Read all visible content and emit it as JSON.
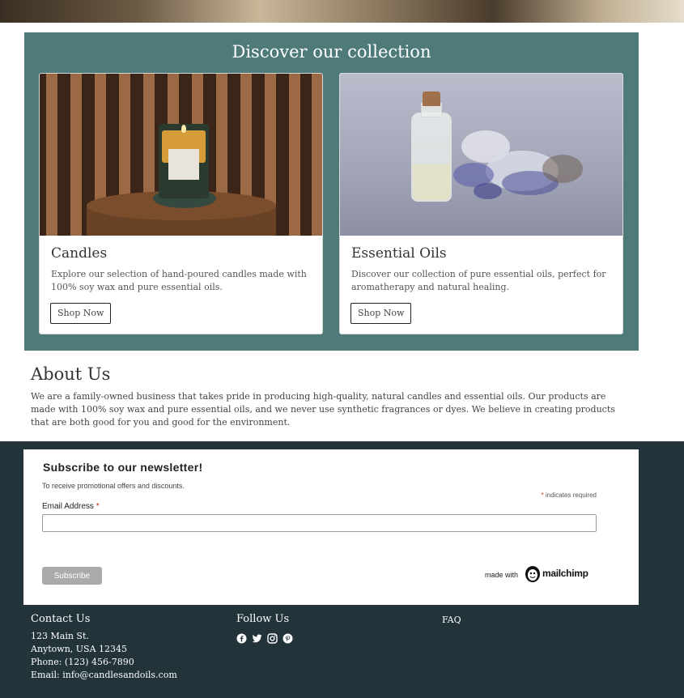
{
  "collection": {
    "title": "Discover our collection",
    "cards": [
      {
        "title": "Candles",
        "description": "Explore our selection of hand-poured candles made with 100% soy wax and pure essential oils.",
        "button": "Shop Now"
      },
      {
        "title": "Essential Oils",
        "description": "Discover our collection of pure essential oils, perfect for aromatherapy and natural healing.",
        "button": "Shop Now"
      }
    ]
  },
  "about": {
    "title": "About Us",
    "text": "We are a family-owned business that takes pride in producing high-quality, natural candles and essential oils. Our products are made with 100% soy wax and pure essential oils, and we never use synthetic fragrances or dyes. We believe in creating products that are both good for you and good for the environment."
  },
  "newsletter": {
    "title": "Subscribe to our newsletter!",
    "promo": "To receive promotional offers and discounts.",
    "required_star": "*",
    "required_note": "indicates required",
    "email_label": "Email Address",
    "email_value": "",
    "subscribe_label": "Subscribe",
    "made_with": "made with",
    "brand": "mailchimp"
  },
  "footer": {
    "contact_title": "Contact Us",
    "contact_lines": [
      "123 Main St.",
      "Anytown, USA 12345",
      "Phone: (123) 456-7890",
      "Email: info@candlesandoils.com"
    ],
    "follow_title": "Follow Us",
    "social_icons": [
      "facebook-icon",
      "twitter-icon",
      "instagram-icon",
      "pinterest-icon"
    ],
    "faq": "FAQ"
  },
  "colors": {
    "collection_bg": "#4e7a7a",
    "footer_bg": "#22343a",
    "required": "#c02b0a"
  }
}
